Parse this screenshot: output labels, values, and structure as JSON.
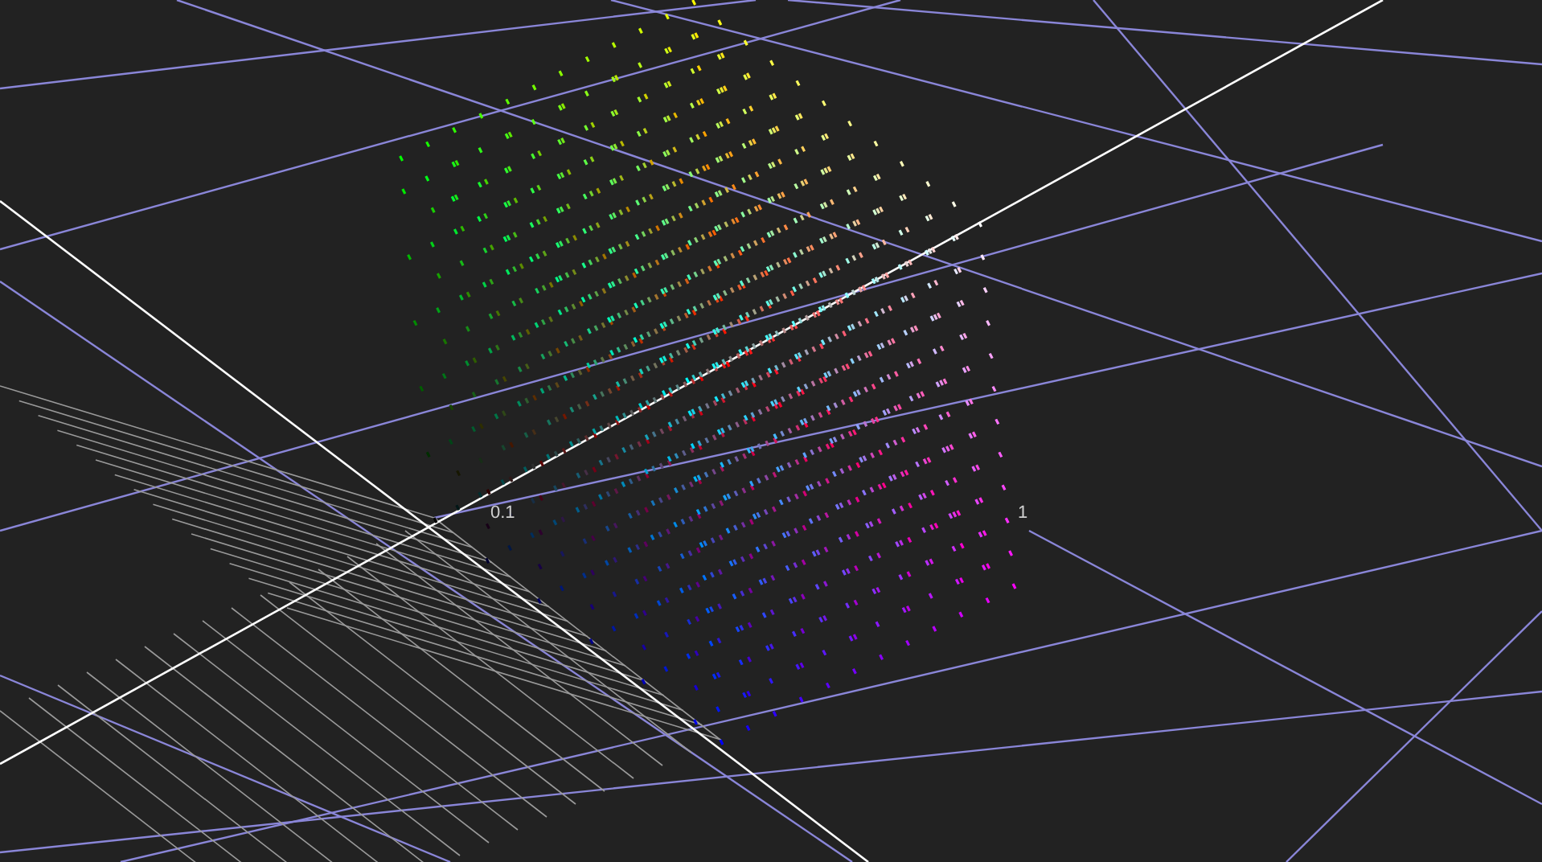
{
  "viewport": {
    "axis_labels": [
      {
        "text": "0.1"
      },
      {
        "text": "1"
      }
    ]
  }
}
